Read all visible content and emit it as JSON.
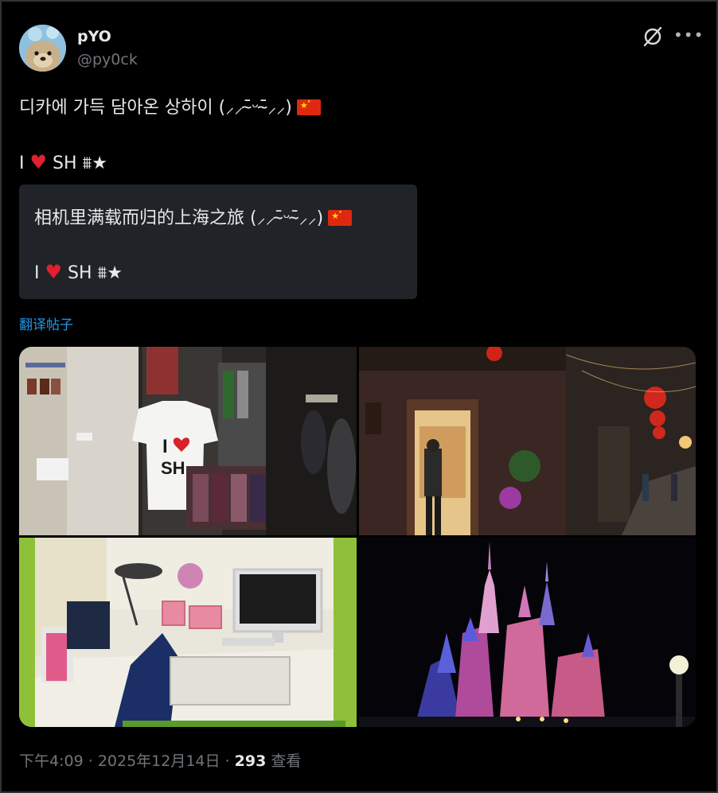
{
  "author": {
    "name": "pYO",
    "handle": "@py0ck"
  },
  "post": {
    "line1": "디카에 가득 담아온 상하이 (⸝⸝ˉ̴̄ᵕˉ̴̄⸝⸝)",
    "line2_prefix": "I",
    "line2_suffix": "SH ⩩★"
  },
  "translation": {
    "line1": "相机里满载而归的上海之旅 (⸝⸝ˉ̴̄ᵕˉ̴̄⸝⸝)",
    "line2_prefix": "I",
    "line2_suffix": "SH ⩩★",
    "link_label": "翻译帖子"
  },
  "photos": {
    "shirt_text_line1": "I",
    "shirt_text_line2": "SH"
  },
  "footer": {
    "time": "下午4:09",
    "date": "2025年12月14日",
    "sep": "·",
    "views_count": "293",
    "views_label": "查看"
  },
  "icons": {
    "grok": "grok-icon",
    "more": "more-icon",
    "flag": "china-flag-icon",
    "heart": "red-heart-icon"
  },
  "colors": {
    "background": "#000000",
    "text": "#e7e9ea",
    "secondary_text": "#71767b",
    "link": "#1d9bf0",
    "translation_box": "#202327"
  }
}
